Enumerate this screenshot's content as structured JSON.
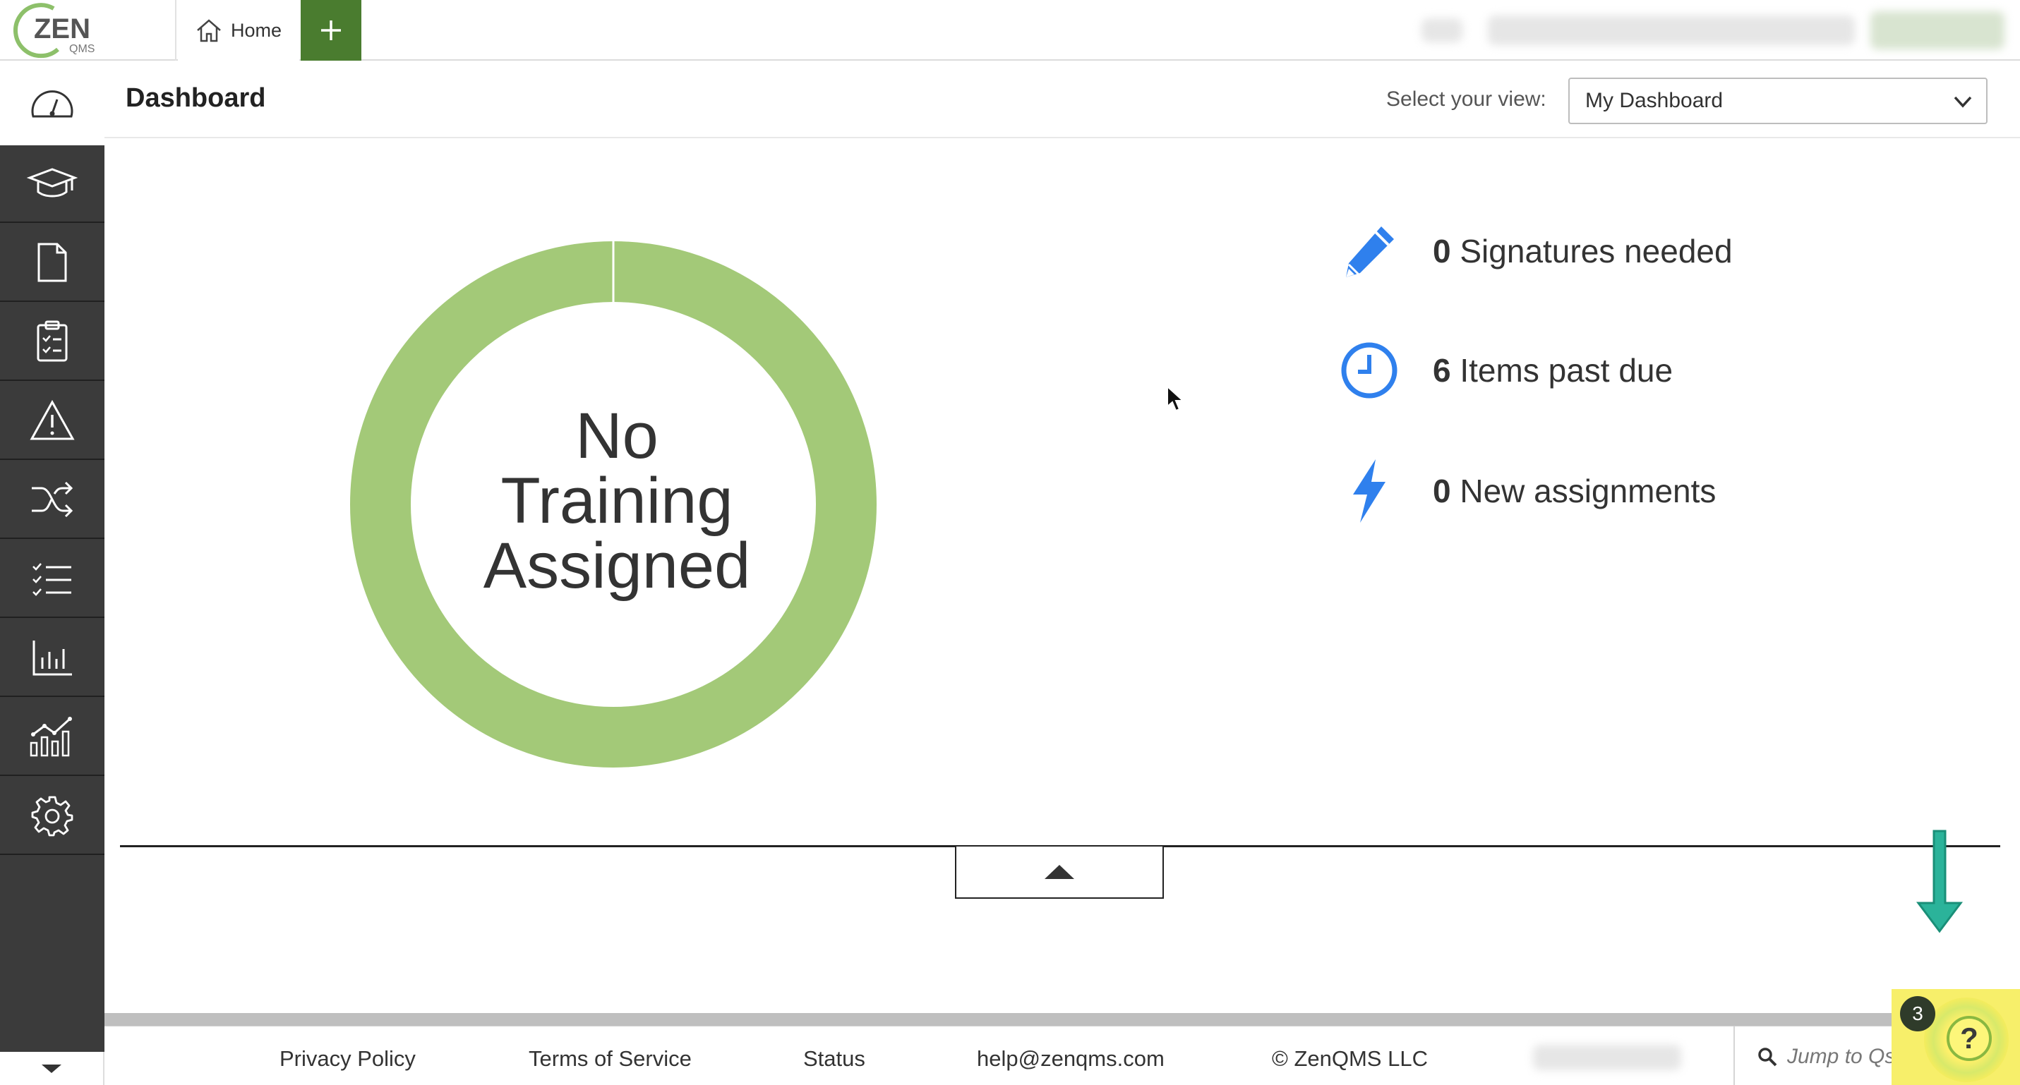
{
  "brand": {
    "logo_text": "ZEN",
    "logo_sub": "QMS",
    "accent_green": "#4a7c2f",
    "donut_green": "#a3c978",
    "icon_blue": "#2f80ed",
    "arrow_teal": "#2bb39a"
  },
  "topbar": {
    "home_tab_label": "Home",
    "home_icon": "home-icon",
    "add_tab_icon": "plus-icon"
  },
  "sidebar": {
    "items": [
      {
        "name": "dashboard",
        "icon": "speedometer-icon"
      },
      {
        "name": "training",
        "icon": "graduation-cap-icon"
      },
      {
        "name": "documents",
        "icon": "document-icon"
      },
      {
        "name": "audits",
        "icon": "clipboard-icon"
      },
      {
        "name": "events",
        "icon": "warning-icon"
      },
      {
        "name": "change-control",
        "icon": "shuffle-icon"
      },
      {
        "name": "tasks",
        "icon": "checklist-icon"
      },
      {
        "name": "reports",
        "icon": "bar-chart-icon"
      },
      {
        "name": "analytics",
        "icon": "trend-chart-icon"
      },
      {
        "name": "settings",
        "icon": "gear-icon"
      }
    ],
    "expand_icon": "chevron-down-icon"
  },
  "header": {
    "title": "Dashboard",
    "view_label": "Select your view:",
    "view_selected": "My Dashboard"
  },
  "training_chart": {
    "line1": "No",
    "line2": "Training",
    "line3": "Assigned"
  },
  "stats": [
    {
      "count": "0",
      "label": "Signatures needed",
      "icon": "pencil-icon"
    },
    {
      "count": "6",
      "label": "Items past due",
      "icon": "clock-icon"
    },
    {
      "count": "0",
      "label": "New assignments",
      "icon": "lightning-icon"
    }
  ],
  "footer": {
    "privacy": "Privacy Policy",
    "terms": "Terms of Service",
    "status": "Status",
    "email": "help@zenqms.com",
    "copyright": "© ZenQMS LLC",
    "jump_placeholder": "Jump to Qsheet"
  },
  "help": {
    "badge_count": "3",
    "symbol": "?"
  }
}
